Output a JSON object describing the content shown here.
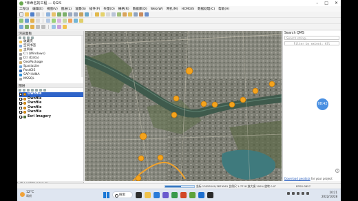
{
  "window": {
    "title": "*未命名的工程 — QGIS"
  },
  "menu": [
    "工程(J)",
    "编辑(E)",
    "视图(V)",
    "图层(L)",
    "设置(S)",
    "插件(P)",
    "矢量(O)",
    "栅格(R)",
    "数据库(D)",
    "Web(W)",
    "网孔(M)",
    "HCMGIS",
    "数据处理(C)",
    "帮助(H)"
  ],
  "browser": {
    "title": "浏览面板",
    "items": [
      "收藏夹",
      "空间书签",
      "主目录",
      "C:\\ (Windows)",
      "D:\\ (Data)",
      "GeoPackage",
      "SpatiaLite",
      "PostGIS",
      "SAP HANA",
      "MSSQL"
    ]
  },
  "layers": {
    "title": "图层",
    "items": [
      {
        "label": "Ownfile",
        "checked": false,
        "selected": true,
        "symbol": "point"
      },
      {
        "label": "Ownfile",
        "checked": true,
        "selected": false,
        "symbol": "point"
      },
      {
        "label": "Ownfile",
        "checked": true,
        "selected": false,
        "symbol": "point"
      },
      {
        "label": "Ownfile",
        "checked": false,
        "selected": false,
        "symbol": "point"
      },
      {
        "label": "Ownfile",
        "checked": true,
        "selected": false,
        "symbol": "point"
      },
      {
        "label": "Esri Imagery",
        "checked": true,
        "selected": false,
        "symbol": "raster"
      }
    ]
  },
  "locator": {
    "placeholder": "输入以定位 (Ctrl+K)"
  },
  "search_panel": {
    "title": "Search QMS",
    "search_placeholder": "Search string...",
    "filter_label": "Filter by extent: All",
    "footer_link": "Download geodata",
    "footer_text": "for your project",
    "help": "?"
  },
  "overlay_clock": "08:42",
  "statusbar": {
    "progress": 0.55,
    "coordinate": "坐标 13055109,3879561  比例尺 1:7718  放大镜 100%  旋转 0.0°",
    "crs": "EPSG:3857"
  },
  "taskbar": {
    "weather_temp": "12°C",
    "weather_desc": "晴朗",
    "search_label": "搜索",
    "time": "20:21",
    "date": "2022/10/28"
  },
  "colors": {
    "selection": "#2f64c9",
    "point_fill": "#f4a31d",
    "route_line": "#f2a32c"
  }
}
